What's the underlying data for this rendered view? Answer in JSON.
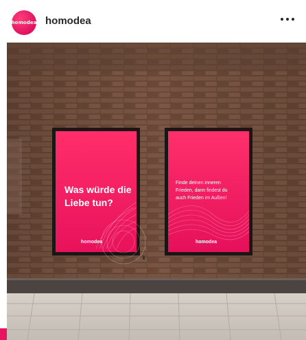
{
  "post": {
    "account_name": "homodea",
    "avatar_text": "homodea",
    "more_icon": "more-horizontal-icon"
  },
  "billboards": [
    {
      "headline_line1": "Was würde die",
      "headline_line2": "Liebe tun?",
      "brand": "homodea"
    },
    {
      "body_line1": "Finde deinen inneren",
      "body_line2": "Frieden, dann findest du",
      "body_line3": "auch Frieden im Außen!",
      "brand": "homodea"
    }
  ],
  "colors": {
    "brand_pink": "#e7145f",
    "brick": "#6b4a3a",
    "pavement": "#cfc9c2"
  }
}
